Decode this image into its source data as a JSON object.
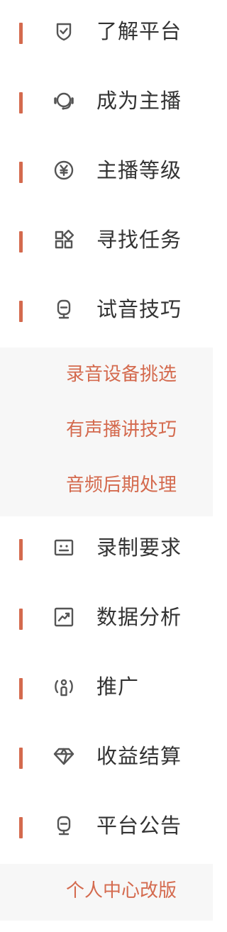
{
  "menu": {
    "items": [
      {
        "label": "了解平台",
        "icon": "shield-check-icon"
      },
      {
        "label": "成为主播",
        "icon": "headset-icon"
      },
      {
        "label": "主播等级",
        "icon": "yen-circle-icon"
      },
      {
        "label": "寻找任务",
        "icon": "grid-apps-icon"
      },
      {
        "label": "试音技巧",
        "icon": "microphone-icon"
      },
      {
        "label": "录制要求",
        "icon": "screen-icon"
      },
      {
        "label": "数据分析",
        "icon": "trend-chart-icon"
      },
      {
        "label": "推广",
        "icon": "broadcast-person-icon"
      },
      {
        "label": "收益结算",
        "icon": "diamond-icon"
      },
      {
        "label": "平台公告",
        "icon": "microphone-icon"
      }
    ],
    "submenu_trial": [
      "录音设备挑选",
      "有声播讲技巧",
      "音频后期处理"
    ],
    "submenu_announce": [
      "个人中心改版"
    ]
  },
  "colors": {
    "accent": "#d46a4e",
    "text": "#333333",
    "icon": "#555555",
    "submenu_bg": "#f7f7f7"
  }
}
